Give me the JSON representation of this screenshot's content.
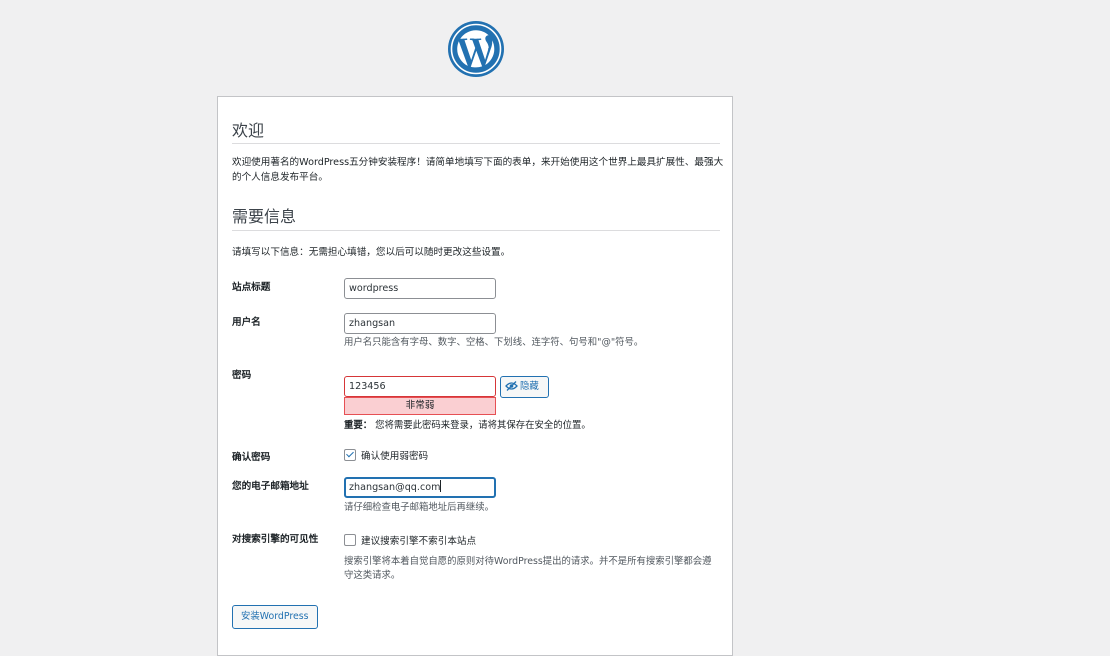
{
  "header": {
    "logo_icon": "wordpress-logo-icon"
  },
  "welcome": {
    "title": "欢迎",
    "intro": "欢迎使用著名的WordPress五分钟安装程序！请简单地填写下面的表单，来开始使用这个世界上最具扩展性、最强大的个人信息发布平台。"
  },
  "info": {
    "title": "需要信息",
    "intro": "请填写以下信息：无需担心填错，您以后可以随时更改这些设置。"
  },
  "form": {
    "site_title": {
      "label": "站点标题",
      "value": "wordpress"
    },
    "username": {
      "label": "用户名",
      "value": "zhangsan",
      "hint": "用户名只能含有字母、数字、空格、下划线、连字符、句号和\"@\"符号。"
    },
    "password": {
      "label": "密码",
      "value": "123456",
      "strength": "非常弱",
      "hide_label": "隐藏",
      "hide_icon": "eye-slash-icon",
      "note_bold": "重要：",
      "note": "您将需要此密码来登录，请将其保存在安全的位置。"
    },
    "confirm": {
      "label": "确认密码",
      "checkbox_label": "确认使用弱密码",
      "checked": true
    },
    "email": {
      "label": "您的电子邮箱地址",
      "value": "zhangsan@qq.com",
      "hint": "请仔细检查电子邮箱地址后再继续。"
    },
    "visibility": {
      "label": "对搜索引擎的可见性",
      "checkbox_label": "建议搜索引擎不索引本站点",
      "checked": false,
      "hint": "搜索引擎将本着自觉自愿的原则对待WordPress提出的请求。并不是所有搜索引擎都会遵守这类请求。"
    },
    "install_label": "安装WordPress"
  },
  "colors": {
    "accent": "#2271b1",
    "danger": "#d63638",
    "weak_bg": "#facfd2",
    "logo": "#2271b1"
  }
}
